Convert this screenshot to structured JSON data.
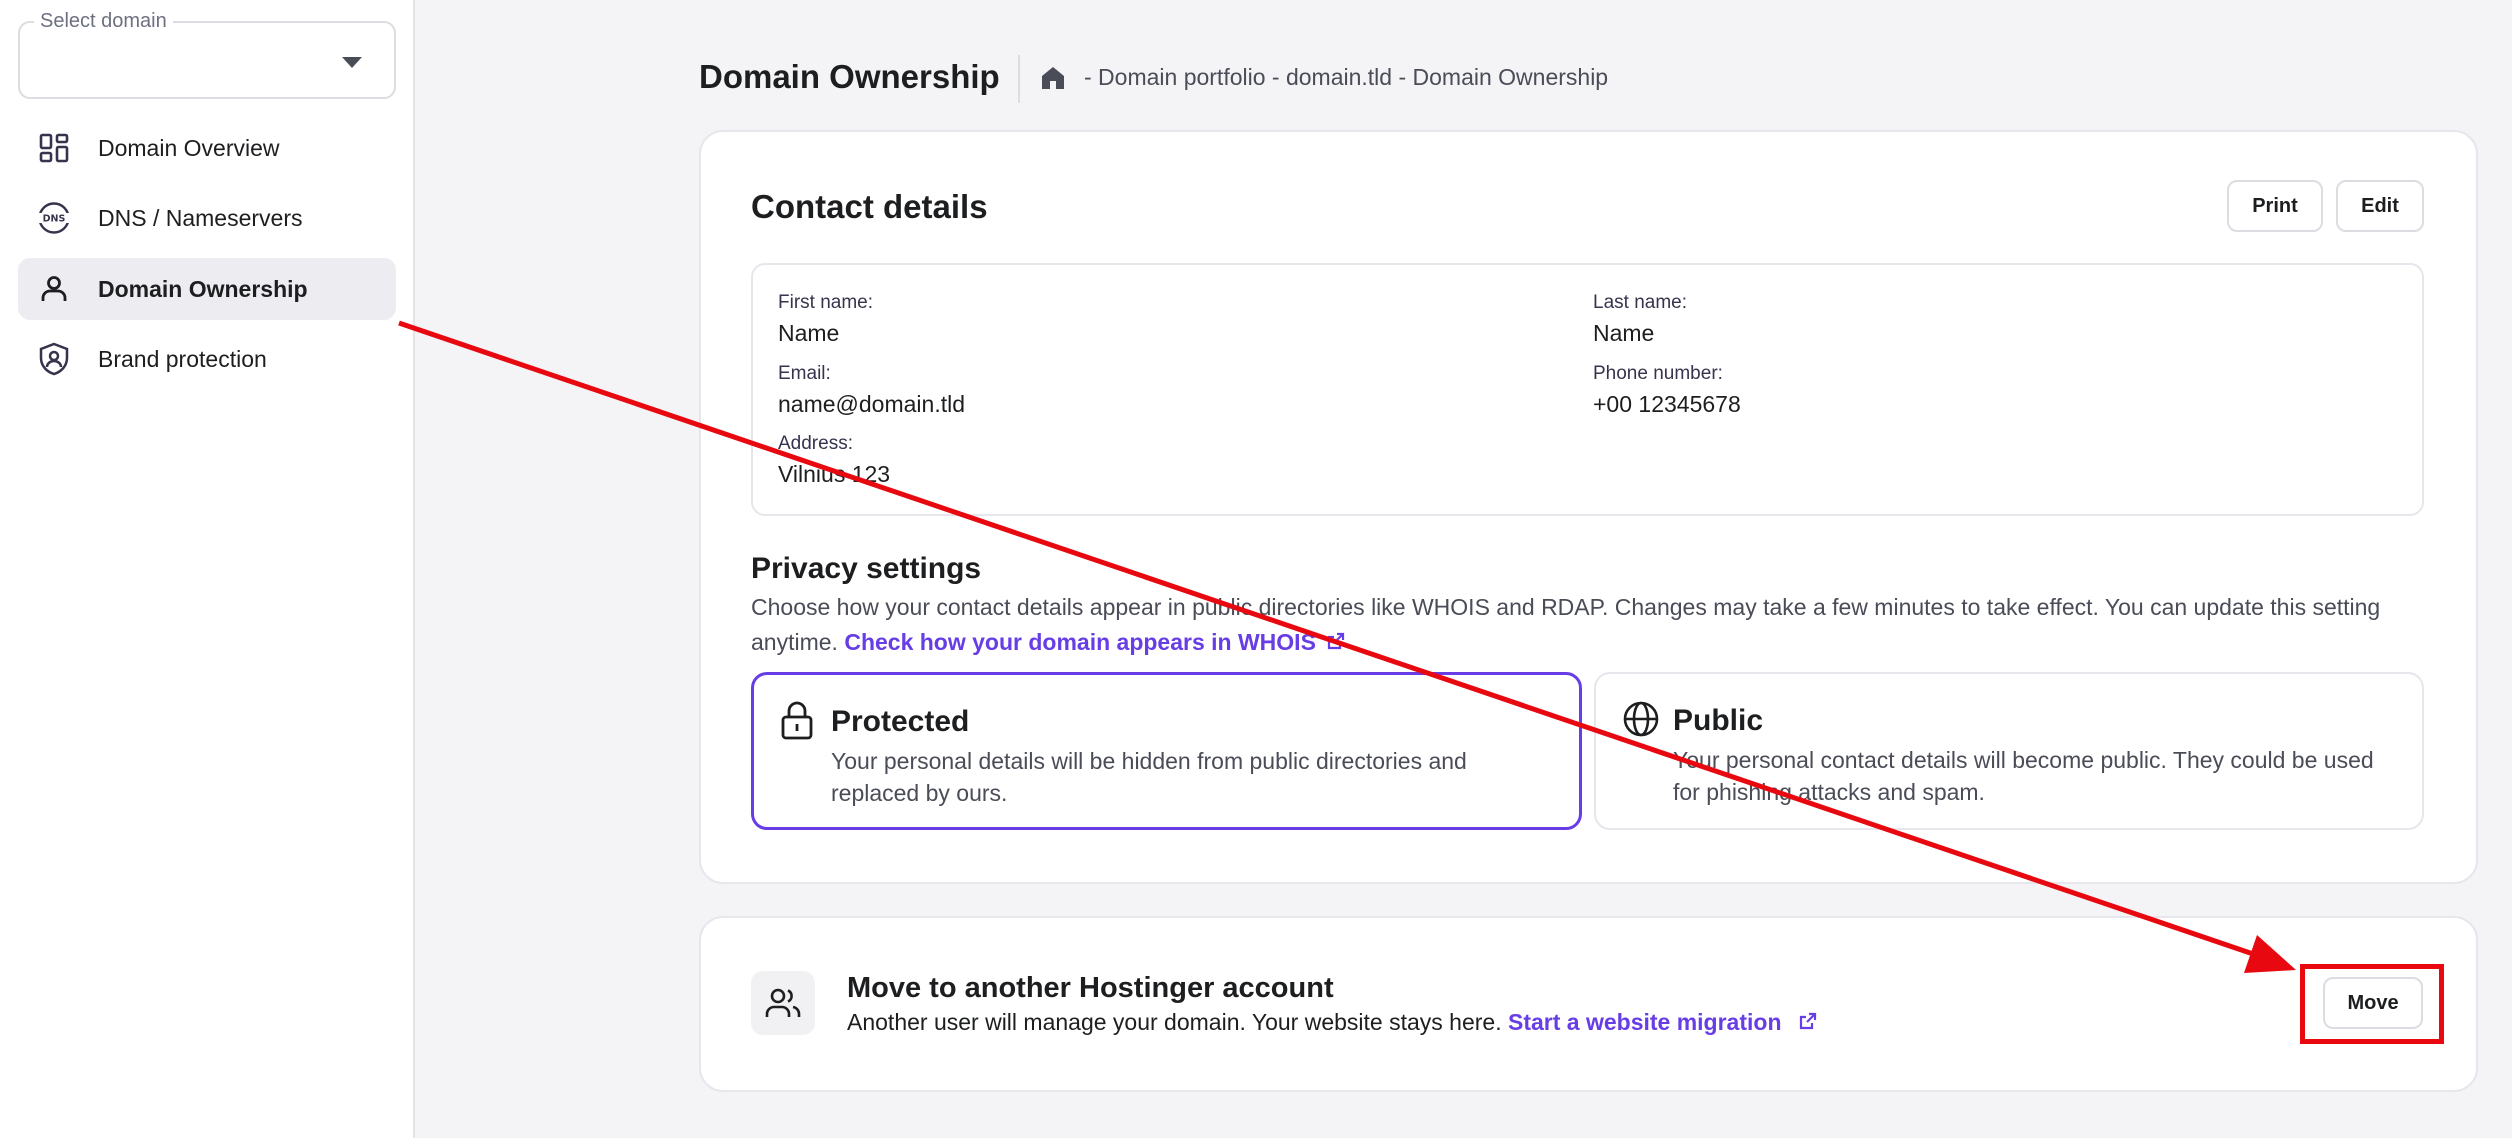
{
  "sidebar": {
    "domain_select": {
      "label": "Select domain",
      "value": ""
    },
    "items": [
      {
        "label": "Domain Overview",
        "icon": "grid-icon",
        "active": false
      },
      {
        "label": "DNS / Nameservers",
        "icon": "dns-icon",
        "active": false
      },
      {
        "label": "Domain Ownership",
        "icon": "person-icon",
        "active": true
      },
      {
        "label": "Brand protection",
        "icon": "shield-icon",
        "active": false
      }
    ]
  },
  "header": {
    "title": "Domain Ownership",
    "breadcrumb": "- Domain portfolio - domain.tld - Domain Ownership"
  },
  "contact": {
    "title": "Contact details",
    "print_label": "Print",
    "edit_label": "Edit",
    "first_name_label": "First name:",
    "first_name": "Name",
    "last_name_label": "Last name:",
    "last_name": "Name",
    "email_label": "Email:",
    "email": "name@domain.tld",
    "phone_label": "Phone number:",
    "phone": "+00 12345678",
    "address_label": "Address:",
    "address": "Vilnius 123"
  },
  "privacy": {
    "title": "Privacy settings",
    "description": "Choose how your contact details appear in public directories like WHOIS and RDAP. Changes may take a few minutes to take effect. You can update this setting anytime.",
    "link": "Check how your domain appears in WHOIS",
    "options": {
      "protected": {
        "title": "Protected",
        "description": "Your personal details will be hidden from public directories and replaced by ours.",
        "selected": true
      },
      "public": {
        "title": "Public",
        "description": "Your personal contact details will become public. They could be used for phishing attacks and spam.",
        "selected": false
      }
    }
  },
  "move": {
    "title": "Move to another Hostinger account",
    "description": "Another user will manage your domain. Your website stays here.",
    "link": "Start a website migration",
    "button_label": "Move"
  },
  "colors": {
    "accent": "#673de6",
    "annotation": "#e8080f",
    "background": "#f4f4f6",
    "active_nav": "#ededf1"
  }
}
